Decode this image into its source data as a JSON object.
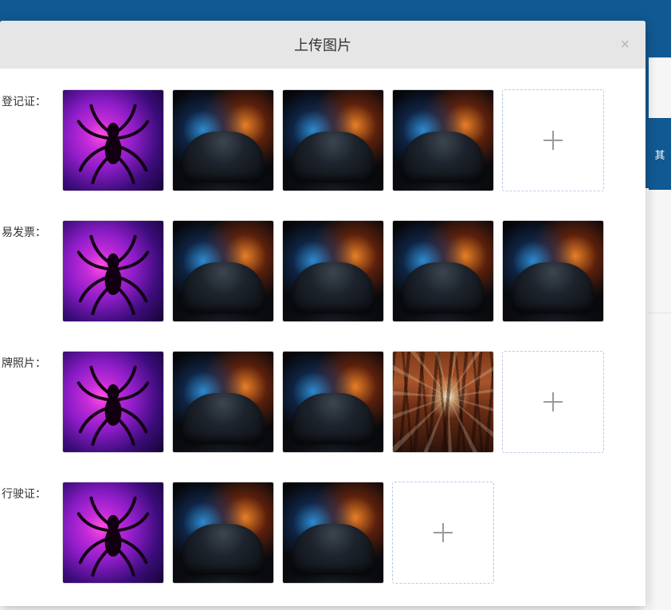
{
  "modal": {
    "title": "上传图片",
    "close": "×"
  },
  "rows": [
    {
      "label": "登记证：",
      "thumbs": [
        {
          "kind": "spider"
        },
        {
          "kind": "car"
        },
        {
          "kind": "car"
        },
        {
          "kind": "car"
        }
      ],
      "has_uploader": true
    },
    {
      "label": "易发票：",
      "thumbs": [
        {
          "kind": "spider"
        },
        {
          "kind": "car"
        },
        {
          "kind": "car"
        },
        {
          "kind": "car"
        },
        {
          "kind": "car"
        }
      ],
      "has_uploader": false
    },
    {
      "label": "牌照片：",
      "thumbs": [
        {
          "kind": "spider"
        },
        {
          "kind": "car"
        },
        {
          "kind": "car"
        },
        {
          "kind": "forest"
        }
      ],
      "has_uploader": true
    },
    {
      "label": "行驶证：",
      "thumbs": [
        {
          "kind": "spider"
        },
        {
          "kind": "car"
        },
        {
          "kind": "car"
        }
      ],
      "has_uploader": true
    }
  ],
  "sidebar_button": "其",
  "icons": {
    "plus": "plus-icon",
    "close": "close-icon"
  }
}
